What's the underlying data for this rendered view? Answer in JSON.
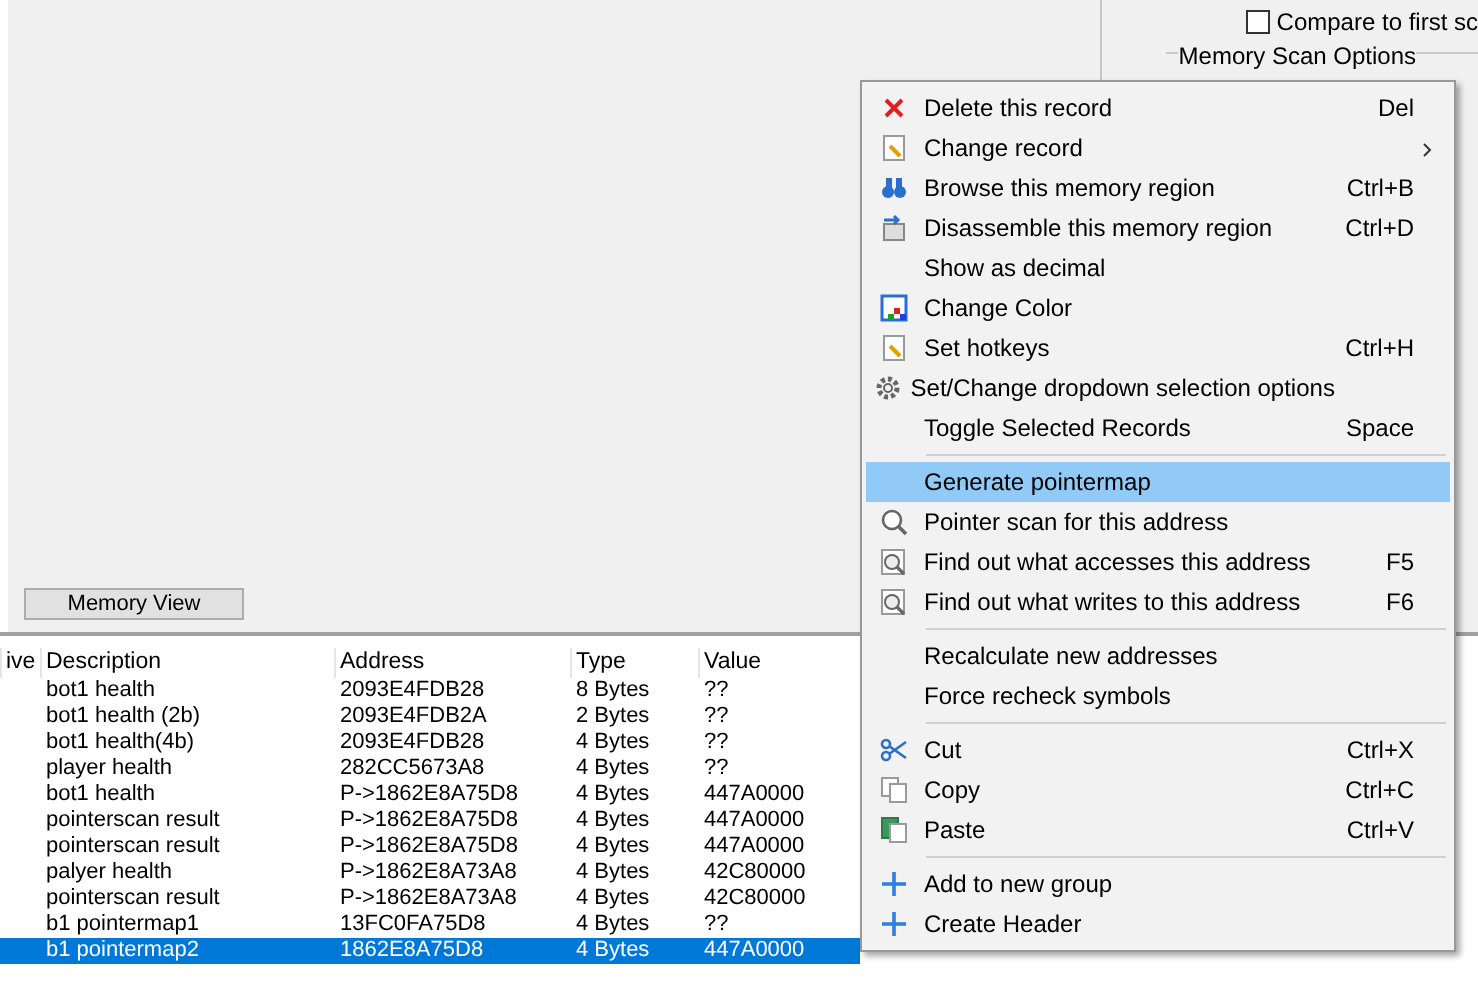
{
  "scan_options": {
    "compare_checkbox": {
      "label": "Compare to first sc",
      "checked": false
    },
    "group_title": "Memory Scan Options"
  },
  "memory_view_button": "Memory View",
  "table": {
    "columns": [
      "ive",
      "Description",
      "Address",
      "Type",
      "Value"
    ],
    "rows": [
      {
        "description": "bot1 health",
        "address": "2093E4FDB28",
        "type": "8 Bytes",
        "value": "??",
        "selected": false
      },
      {
        "description": "bot1 health (2b)",
        "address": "2093E4FDB2A",
        "type": "2 Bytes",
        "value": "??",
        "selected": false
      },
      {
        "description": "bot1 health(4b)",
        "address": "2093E4FDB28",
        "type": "4 Bytes",
        "value": "??",
        "selected": false
      },
      {
        "description": "player health",
        "address": "282CC5673A8",
        "type": "4 Bytes",
        "value": "??",
        "selected": false
      },
      {
        "description": "bot1 health",
        "address": "P->1862E8A75D8",
        "type": "4 Bytes",
        "value": "447A0000",
        "selected": false
      },
      {
        "description": "pointerscan result",
        "address": "P->1862E8A75D8",
        "type": "4 Bytes",
        "value": "447A0000",
        "selected": false
      },
      {
        "description": "pointerscan result",
        "address": "P->1862E8A75D8",
        "type": "4 Bytes",
        "value": "447A0000",
        "selected": false
      },
      {
        "description": "palyer health",
        "address": "P->1862E8A73A8",
        "type": "4 Bytes",
        "value": "42C80000",
        "selected": false
      },
      {
        "description": "pointerscan result",
        "address": "P->1862E8A73A8",
        "type": "4 Bytes",
        "value": "42C80000",
        "selected": false
      },
      {
        "description": "b1 pointermap1",
        "address": "13FC0FA75D8",
        "type": "4 Bytes",
        "value": "??",
        "selected": false
      },
      {
        "description": "b1 pointermap2",
        "address": "1862E8A75D8",
        "type": "4 Bytes",
        "value": "447A0000",
        "selected": true
      }
    ]
  },
  "context_menu": [
    {
      "kind": "delete",
      "label": "Delete this record",
      "shortcut": "Del",
      "submenu": false,
      "selected": false
    },
    {
      "kind": "edit",
      "label": "Change record",
      "submenu": true,
      "selected": false
    },
    {
      "kind": "binoculars",
      "label": "Browse this memory region",
      "shortcut": "Ctrl+B",
      "submenu": false,
      "selected": false
    },
    {
      "kind": "disassemble",
      "label": "Disassemble this memory region",
      "shortcut": "Ctrl+D",
      "submenu": false,
      "selected": false
    },
    {
      "kind": "plain",
      "label": "Show as decimal",
      "submenu": false,
      "selected": false
    },
    {
      "kind": "color",
      "label": "Change Color",
      "submenu": false,
      "selected": false
    },
    {
      "kind": "edit",
      "label": "Set hotkeys",
      "shortcut": "Ctrl+H",
      "submenu": false,
      "selected": false
    },
    {
      "kind": "gear",
      "label": "Set/Change dropdown selection options",
      "submenu": false,
      "selected": false
    },
    {
      "kind": "plain",
      "label": "Toggle Selected Records",
      "shortcut": "Space",
      "submenu": false,
      "selected": false
    },
    {
      "kind": "separator"
    },
    {
      "kind": "plain",
      "label": "Generate pointermap",
      "submenu": false,
      "selected": true
    },
    {
      "kind": "magnifier",
      "label": "Pointer scan for this address",
      "submenu": false,
      "selected": false
    },
    {
      "kind": "magnifier-doc",
      "label": "Find out what accesses this address",
      "shortcut": "F5",
      "submenu": false,
      "selected": false
    },
    {
      "kind": "magnifier-doc",
      "label": "Find out what writes to this address",
      "shortcut": "F6",
      "submenu": false,
      "selected": false
    },
    {
      "kind": "separator"
    },
    {
      "kind": "plain",
      "label": "Recalculate new addresses",
      "submenu": false,
      "selected": false
    },
    {
      "kind": "plain",
      "label": "Force recheck symbols",
      "submenu": false,
      "selected": false
    },
    {
      "kind": "separator"
    },
    {
      "kind": "scissors",
      "label": "Cut",
      "shortcut": "Ctrl+X",
      "submenu": false,
      "selected": false
    },
    {
      "kind": "copy",
      "label": "Copy",
      "shortcut": "Ctrl+C",
      "submenu": false,
      "selected": false
    },
    {
      "kind": "paste",
      "label": "Paste",
      "shortcut": "Ctrl+V",
      "submenu": false,
      "selected": false
    },
    {
      "kind": "separator"
    },
    {
      "kind": "plus",
      "label": "Add to new group",
      "submenu": false,
      "selected": false
    },
    {
      "kind": "plus",
      "label": "Create Header",
      "submenu": false,
      "selected": false
    }
  ]
}
